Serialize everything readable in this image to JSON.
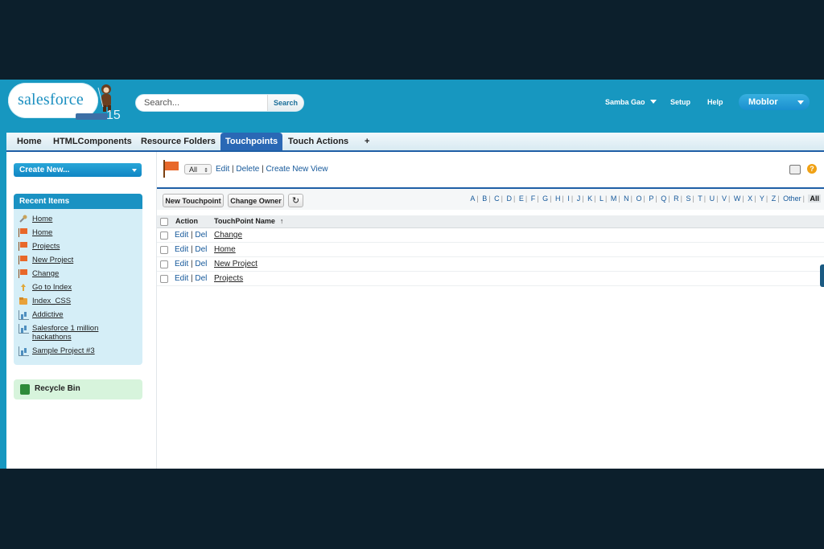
{
  "header": {
    "logo": {
      "text": "salesforce",
      "badge": "15"
    },
    "search": {
      "placeholder": "Search...",
      "button": "Search"
    },
    "user": "Samba Gao",
    "setup": "Setup",
    "help": "Help",
    "app_menu": "Moblor"
  },
  "tabs": [
    {
      "label": "Home"
    },
    {
      "label": "HTMLComponents"
    },
    {
      "label": "Resource Folders"
    },
    {
      "label": "Touchpoints",
      "active": true
    },
    {
      "label": "Touch Actions"
    },
    {
      "label": "+"
    }
  ],
  "sidebar": {
    "create_new": "Create New...",
    "recent_title": "Recent Items",
    "recent_items": [
      {
        "label": "Home",
        "icon": "home-wrench-icon"
      },
      {
        "label": "Home",
        "icon": "flag-icon"
      },
      {
        "label": "Projects",
        "icon": "flag-icon"
      },
      {
        "label": "New Project",
        "icon": "flag-icon"
      },
      {
        "label": "Change",
        "icon": "flag-icon"
      },
      {
        "label": "Go to Index",
        "icon": "action-icon"
      },
      {
        "label": "Index_CSS",
        "icon": "folder-icon"
      },
      {
        "label": "Addictive",
        "icon": "chart-icon"
      },
      {
        "label": "Salesforce 1 million",
        "label2": "hackathons",
        "icon": "chart-icon"
      },
      {
        "label": "Sample Project #3",
        "icon": "chart-icon"
      }
    ],
    "recycle_bin": "Recycle Bin"
  },
  "view": {
    "selected": "All",
    "links": [
      "Edit",
      "Delete",
      "Create New View"
    ]
  },
  "list": {
    "buttons": {
      "new": "New Touchpoint",
      "change_owner": "Change Owner"
    },
    "alphabet": [
      "A",
      "B",
      "C",
      "D",
      "E",
      "F",
      "G",
      "H",
      "I",
      "J",
      "K",
      "L",
      "M",
      "N",
      "O",
      "P",
      "Q",
      "R",
      "S",
      "T",
      "U",
      "V",
      "W",
      "X",
      "Y",
      "Z",
      "Other"
    ],
    "alphabet_all": "All",
    "columns": {
      "action": "Action",
      "name": "TouchPoint Name",
      "sort": "↑"
    },
    "action_edit": "Edit",
    "action_del": "Del",
    "rows": [
      "Change",
      "Home",
      "New Project",
      "Projects"
    ]
  }
}
